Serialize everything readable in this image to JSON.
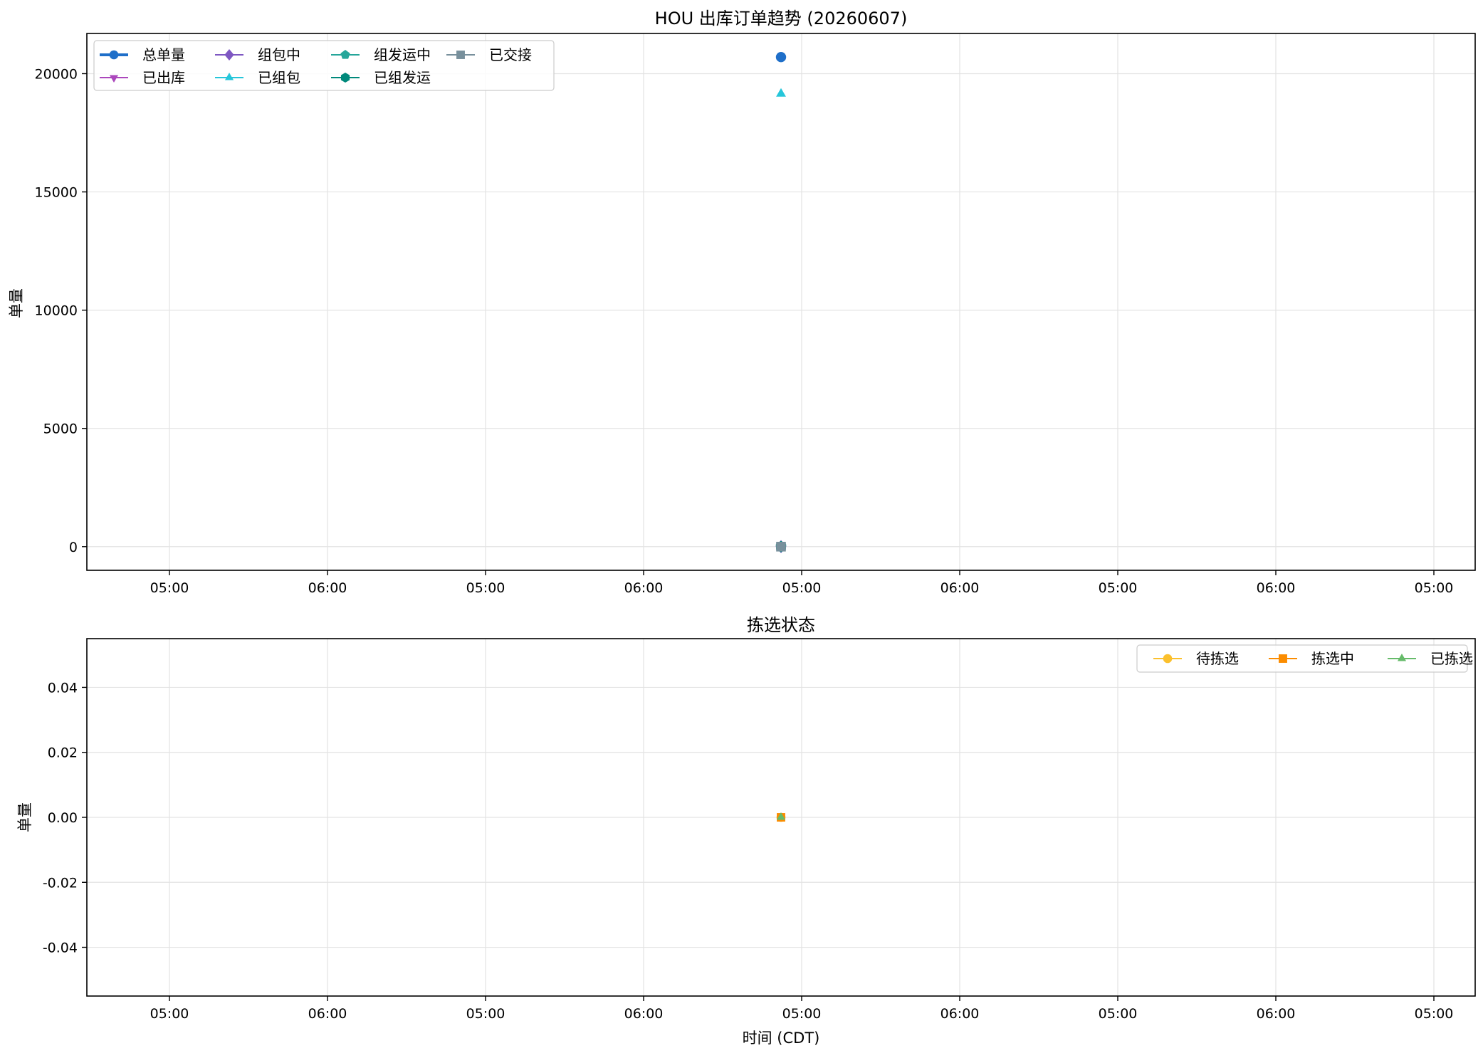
{
  "chart_data": [
    {
      "type": "line",
      "title": "HOU 出库订单趋势 (20260607)",
      "xlabel": "",
      "ylabel": "单量",
      "x_tick_labels": [
        "05:00",
        "06:00",
        "05:00",
        "06:00",
        "05:00",
        "06:00",
        "05:00",
        "06:00",
        "05:00"
      ],
      "y_ticks": [
        0,
        5000,
        10000,
        15000,
        20000
      ],
      "ylim": [
        -1000,
        21700
      ],
      "x_point": "04:52",
      "grid": true,
      "legend_position": "upper-left",
      "legend_columns": 4,
      "series": [
        {
          "name": "总单量",
          "marker": "circle",
          "color": "#1f6fc9",
          "values": [
            20700
          ]
        },
        {
          "name": "已出库",
          "marker": "triangle-down",
          "color": "#ab47bc",
          "values": [
            0
          ]
        },
        {
          "name": "组包中",
          "marker": "diamond",
          "color": "#7e57c2",
          "values": [
            0
          ]
        },
        {
          "name": "已组包",
          "marker": "triangle-up",
          "color": "#26c6da",
          "values": [
            19150
          ]
        },
        {
          "name": "组发运中",
          "marker": "pentagon",
          "color": "#26a69a",
          "values": [
            0
          ]
        },
        {
          "name": "已组发运",
          "marker": "hexagon",
          "color": "#00897b",
          "values": [
            0
          ]
        },
        {
          "name": "已交接",
          "marker": "square",
          "color": "#78909c",
          "values": [
            0
          ]
        }
      ]
    },
    {
      "type": "line",
      "title": "拣选状态",
      "xlabel": "时间 (CDT)",
      "ylabel": "单量",
      "x_tick_labels": [
        "05:00",
        "06:00",
        "05:00",
        "06:00",
        "05:00",
        "06:00",
        "05:00",
        "06:00",
        "05:00"
      ],
      "y_tick_labels": [
        "0.04",
        "0.02",
        "0.00",
        "-0.02",
        "-0.04"
      ],
      "y_ticks": [
        0.04,
        0.02,
        0.0,
        -0.02,
        -0.04
      ],
      "ylim": [
        -0.055,
        0.055
      ],
      "x_point": "04:52",
      "grid": true,
      "legend_position": "upper-right",
      "legend_columns": 3,
      "series": [
        {
          "name": "待拣选",
          "marker": "circle",
          "color": "#fbc02d",
          "values": [
            0
          ]
        },
        {
          "name": "拣选中",
          "marker": "square",
          "color": "#fb8c00",
          "values": [
            0
          ]
        },
        {
          "name": "已拣选",
          "marker": "triangle-up",
          "color": "#66bb6a",
          "values": [
            0
          ]
        }
      ]
    }
  ]
}
